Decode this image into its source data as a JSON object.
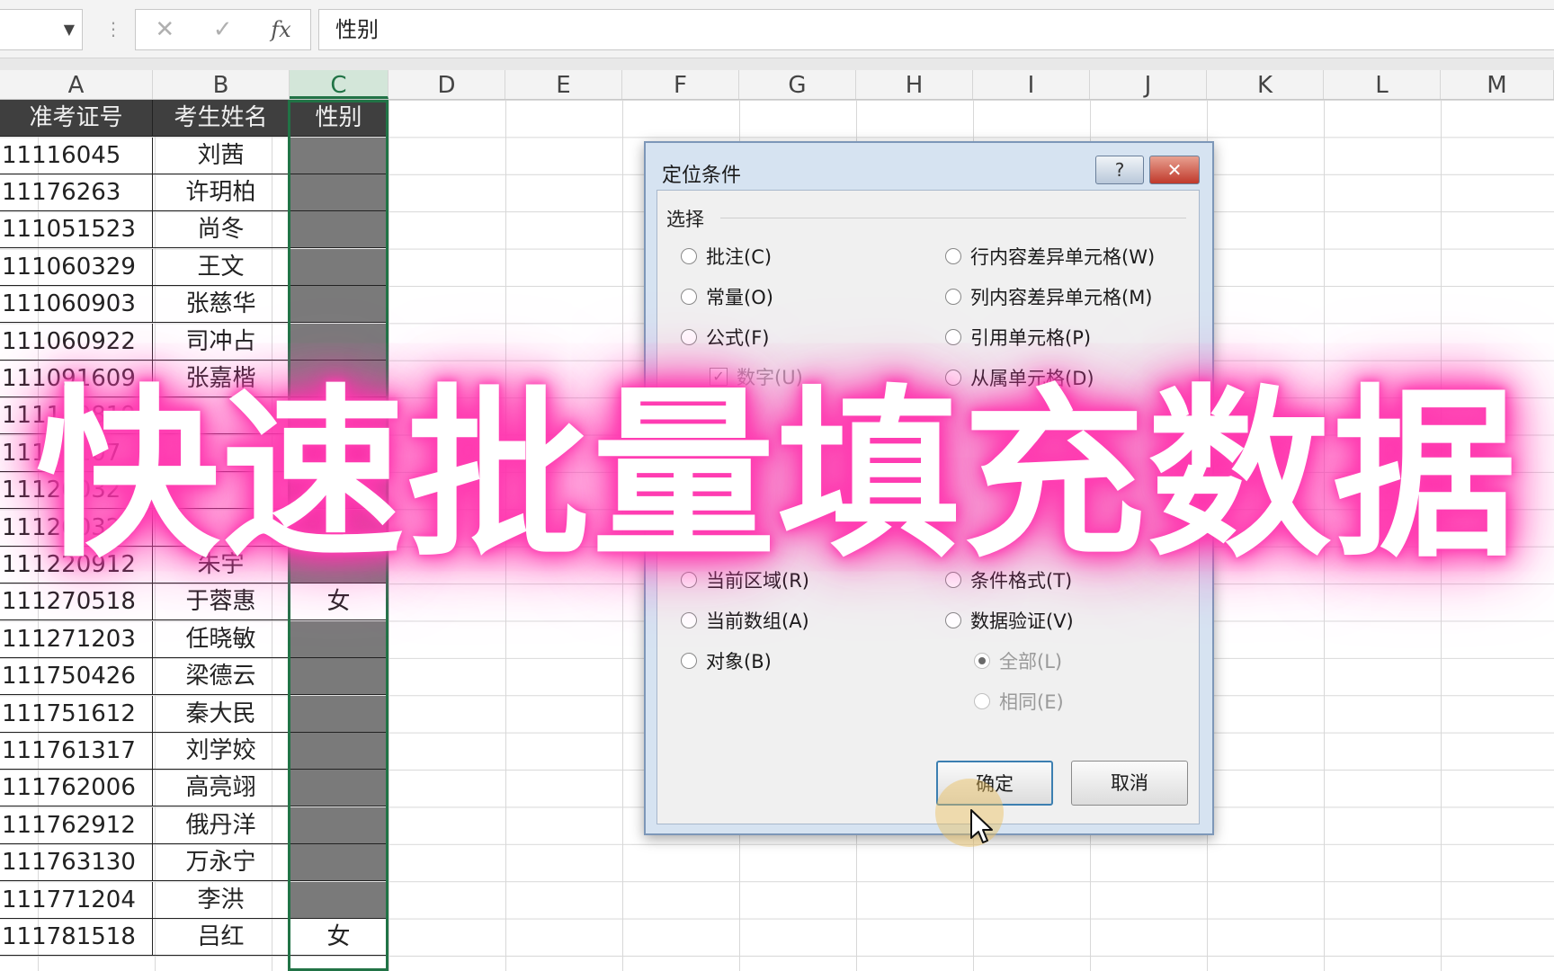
{
  "formula_bar": {
    "content": "性别",
    "cancel_icon": "✕",
    "enter_icon": "✓",
    "fx_label": "fx"
  },
  "columns": [
    "A",
    "B",
    "C",
    "D",
    "E",
    "F",
    "G",
    "H",
    "I",
    "J",
    "K",
    "L",
    "M"
  ],
  "table": {
    "headers": [
      "准考证号",
      "考生姓名",
      "性别"
    ],
    "rows": [
      {
        "id": "11116045",
        "name": "刘茜",
        "gender": ""
      },
      {
        "id": "11176263",
        "name": "许玥柏",
        "gender": ""
      },
      {
        "id": "111051523",
        "name": "尚冬",
        "gender": ""
      },
      {
        "id": "111060329",
        "name": "王文",
        "gender": ""
      },
      {
        "id": "111060903",
        "name": "张慈华",
        "gender": ""
      },
      {
        "id": "111060922",
        "name": "司冲占",
        "gender": ""
      },
      {
        "id": "111091609",
        "name": "张嘉楷",
        "gender": ""
      },
      {
        "id": "111140819",
        "name": "",
        "gender": ""
      },
      {
        "id": "11116107",
        "name": "",
        "gender": ""
      },
      {
        "id": "11120032",
        "name": "",
        "gender": ""
      },
      {
        "id": "111200329",
        "name": "",
        "gender": ""
      },
      {
        "id": "111220912",
        "name": "朱宇",
        "gender": ""
      },
      {
        "id": "111270518",
        "name": "于蓉惠",
        "gender": "女"
      },
      {
        "id": "111271203",
        "name": "任晓敏",
        "gender": ""
      },
      {
        "id": "111750426",
        "name": "梁德云",
        "gender": ""
      },
      {
        "id": "111751612",
        "name": "秦大民",
        "gender": ""
      },
      {
        "id": "111761317",
        "name": "刘学姣",
        "gender": ""
      },
      {
        "id": "111762006",
        "name": "高亮翊",
        "gender": ""
      },
      {
        "id": "111762912",
        "name": "俄丹洋",
        "gender": ""
      },
      {
        "id": "111763130",
        "name": "万永宁",
        "gender": ""
      },
      {
        "id": "111771204",
        "name": "李洪",
        "gender": ""
      },
      {
        "id": "111781518",
        "name": "吕红",
        "gender": "女"
      }
    ]
  },
  "dialog": {
    "title": "定位条件",
    "help_label": "?",
    "close_label": "✕",
    "group_label": "选择",
    "left_options": [
      "批注(C)",
      "常量(O)",
      "公式(F)"
    ],
    "left_sub_check": "数字(U)",
    "left_bottom_options": [
      "当前区域(R)",
      "当前数组(A)",
      "对象(B)"
    ],
    "right_options": [
      "行内容差异单元格(W)",
      "列内容差异单元格(M)",
      "引用单元格(P)",
      "从属单元格(D)"
    ],
    "right_bottom_options": [
      "条件格式(T)",
      "数据验证(V)"
    ],
    "right_sub_options": [
      "全部(L)",
      "相同(E)"
    ],
    "ok_label": "确定",
    "cancel_label": "取消"
  },
  "overlay_title": "快速批量填充数据",
  "colors": {
    "excel_green": "#217346",
    "header_fill": "#3f3f3f",
    "blank_cell_fill": "#7a7a7a",
    "glow_pink": "#ff3fb3"
  }
}
